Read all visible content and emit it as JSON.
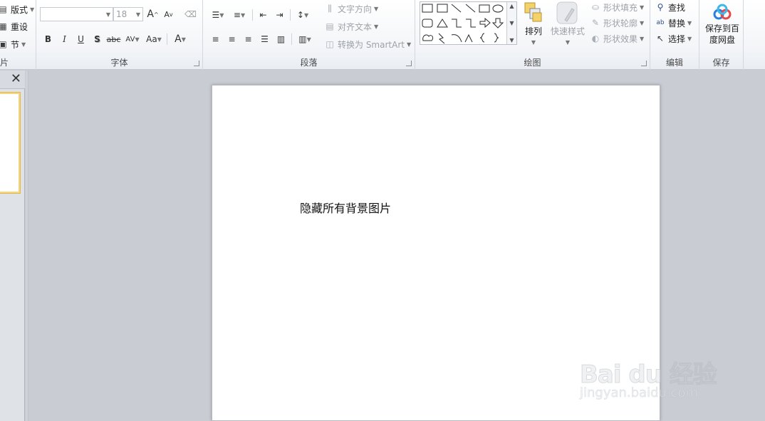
{
  "ribbon": {
    "slides_group": {
      "label": "片",
      "layout_label": "版式",
      "reset_label": "重设",
      "section_label": "节"
    },
    "font_group": {
      "label": "字体",
      "font_name": "",
      "font_size": "18",
      "bold": "B",
      "italic": "I",
      "underline": "U",
      "shadow": "S",
      "strikethrough": "abc",
      "spacing": "AV",
      "change_case": "Aa",
      "font_color": "A",
      "grow": "A",
      "shrink": "A"
    },
    "paragraph_group": {
      "label": "段落",
      "text_direction": "文字方向",
      "align_text": "对齐文本",
      "convert_smartart": "转换为 SmartArt"
    },
    "drawing_group": {
      "label": "绘图",
      "arrange": "排列",
      "quick_styles": "快速样式",
      "shape_fill": "形状填充",
      "shape_outline": "形状轮廓",
      "shape_effects": "形状效果"
    },
    "editing_group": {
      "label": "编辑",
      "find": "查找",
      "replace": "替换",
      "select": "选择"
    },
    "save_group": {
      "label": "保存",
      "save_baidu_line1": "保存到百",
      "save_baidu_line2": "度网盘"
    }
  },
  "slide": {
    "text": "隐藏所有背景图片"
  },
  "watermark": {
    "brand": "Bai du 经验",
    "url": "jingyan.baidu.com"
  },
  "colors": {
    "accent_yellow": "#f4d47c",
    "ribbon_bg": "#f3f5f8",
    "workspace_bg": "#c9cdd3"
  }
}
